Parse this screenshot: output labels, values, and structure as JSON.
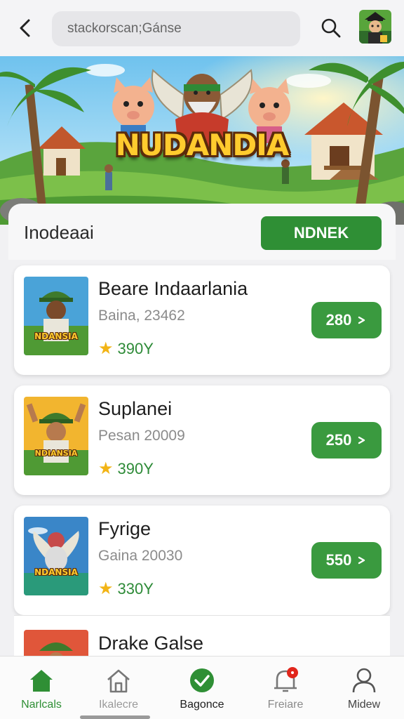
{
  "topbar": {
    "search_value": "stackorscan;Gánse"
  },
  "banner": {
    "title": "NUDANDIA"
  },
  "section": {
    "title": "Inodeaai",
    "button_label": "NDNEK"
  },
  "items": [
    {
      "title": "Beare Indaarlania",
      "subtitle": "Baina, 23462",
      "rating": "390Y",
      "price": "280",
      "thumb_text": "NDANSIA",
      "thumb_bg": "#4aa3d8"
    },
    {
      "title": "Suplanei",
      "subtitle": "Pesan 20009",
      "rating": "390Y",
      "price": "250",
      "thumb_text": "NDIANSIA",
      "thumb_bg": "#f2b52f"
    },
    {
      "title": "Fyrige",
      "subtitle": "Gaina 20030",
      "rating": "330Y",
      "price": "550",
      "thumb_text": "NDANSIA",
      "thumb_bg": "#3a86c8"
    },
    {
      "title": "Drake Galse"
    }
  ],
  "nav": [
    {
      "label": "Narlcals",
      "icon": "home-icon",
      "active": true
    },
    {
      "label": "Ikalecre",
      "icon": "house-outline-icon"
    },
    {
      "label": "Bagonce",
      "icon": "check-circle-icon"
    },
    {
      "label": "Freiare",
      "icon": "bell-icon"
    },
    {
      "label": "Midew",
      "icon": "user-icon"
    }
  ],
  "colors": {
    "accent_green": "#2f8f35",
    "price_green": "#3a9a3f",
    "badge_red": "#e1261c"
  }
}
